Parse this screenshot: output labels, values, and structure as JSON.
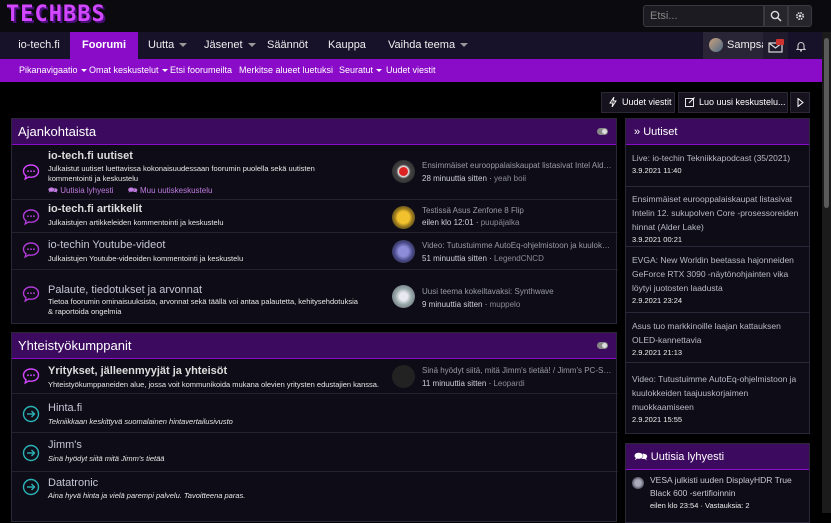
{
  "logo": {
    "text": "TECHBBS"
  },
  "search": {
    "placeholder": "Etsi..."
  },
  "nav": {
    "tabs": [
      {
        "label": "io-tech.fi",
        "caret": false
      },
      {
        "label": "Foorumi",
        "caret": false,
        "active": true
      },
      {
        "label": "Uutta",
        "caret": true
      },
      {
        "label": "Jäsenet",
        "caret": true
      },
      {
        "label": "Säännöt",
        "caret": false
      },
      {
        "label": "Kauppa",
        "caret": false
      },
      {
        "label": "Vaihda teema",
        "caret": true
      }
    ],
    "user": "Sampsa"
  },
  "subnav": {
    "items": [
      {
        "label": "Pikanavigaatio",
        "caret": true
      },
      {
        "label": "Omat keskustelut",
        "caret": true
      },
      {
        "label": "Etsi foorumeilta",
        "caret": false
      },
      {
        "label": "Merkitse alueet luetuksi",
        "caret": false
      },
      {
        "label": "Seuratut",
        "caret": true
      },
      {
        "label": "Uudet viestit",
        "caret": false
      }
    ]
  },
  "actions": {
    "new_posts": "Uudet viestit",
    "new_thread": "Luo uusi keskustelu..."
  },
  "colors": {
    "accent": "#8a0cc8",
    "header": "#3c0b5f",
    "link": "#bf7be0"
  },
  "ajankohtaista": {
    "title": "Ajankohtaista",
    "forums": [
      {
        "name": "io-tech.fi uutiset",
        "desc": "Julkaistut uutiset luettavissa kokonaisuudessaan foorumin puolella sekä uutisten kommentointi ja keskustelu",
        "sublinks": [
          "Uutisia lyhyesti",
          "Muu uutiskeskustelu"
        ],
        "last_title": "Ensimmäiset eurooppalaiskaupat listasivat Intel Alder Lake",
        "last_time": "28 minuuttia sitten",
        "last_user": "yeah boii"
      },
      {
        "name": "io-tech.fi artikkelit",
        "desc": "Julkaistujen artikkeleiden kommentointi ja keskustelu",
        "last_title": "Testissä Asus Zenfone 8 Flip",
        "last_time": "eilen klo 12:01",
        "last_user": "puupäjalka"
      },
      {
        "name": "io-techin Youtube-videot",
        "desc": "Julkaistujen Youtube-videoiden kommentointi ja keskustelu",
        "last_title": "Video: Tutustuimme AutoEq-ohjelmistoon ja kuulokkeiden",
        "last_time": "51 minuuttia sitten",
        "last_user": "LegendCNCD"
      },
      {
        "name": "Palaute, tiedotukset ja arvonnat",
        "desc": "Tietoa foorumin ominaisuuksista, arvonnat sekä täällä voi antaa palautetta, kehitysehdotuksia & raportoida ongelmia",
        "last_title": "Uusi teema kokeiltavaksi: Synthwave",
        "last_time": "9 minuuttia sitten",
        "last_user": "muppelo"
      }
    ]
  },
  "yhteistyo": {
    "title": "Yhteistyökumppanit",
    "forums": [
      {
        "name": "Yritykset, jälleenmyyjät ja yhteisöt",
        "desc": "Yhteistyökumppaneiden alue, jossa voit kommunikoida mukana olevien yritysten edustajien kanssa.",
        "last_title": "Sinä hyödyt siitä, mitä Jimm's tietää! / Jimm's PC-Store",
        "last_time": "11 minuuttia sitten",
        "last_user": "Leopardi"
      },
      {
        "name": "Hinta.fi",
        "desc": "Tekniikkaan keskittyvä suomalainen hintavertailusivusto"
      },
      {
        "name": "Jimm's",
        "desc": "Sinä hyödyt siitä mitä Jimm's tietää"
      },
      {
        "name": "Datatronic",
        "desc": "Aina hyvä hinta ja vielä parempi palvelu. Tavoitteena paras."
      }
    ]
  },
  "sidebar": {
    "news_title": "Uutiset",
    "news": [
      {
        "title": "Live: io-techin Tekniikkapodcast (35/2021)",
        "date": "3.9.2021 11:40"
      },
      {
        "title": "Ensimmäiset eurooppalaiskaupat listasivat Intelin 12. sukupolven Core -prosessoreiden hinnat (Alder Lake)",
        "date": "3.9.2021 00:21"
      },
      {
        "title": "EVGA: New Worldin beetassa hajonneiden GeForce RTX 3090 -näytönohjainten vika löytyi juotosten laadusta",
        "date": "2.9.2021 23:24"
      },
      {
        "title": "Asus tuo markkinoille laajan kattauksen OLED-kannettavia",
        "date": "2.9.2021 21:13"
      },
      {
        "title": "Video: Tutustuimme AutoEq-ohjelmistoon ja kuulokkeiden taajuuskorjaimen muokkaamiseen",
        "date": "2.9.2021 15:55"
      }
    ],
    "short_title": "Uutisia lyhyesti",
    "short": [
      {
        "title": "VESA julkisti uuden DisplayHDR True Black 600 -sertifioinnin",
        "meta": "eilen klo 23:54 · Vastauksia: 2"
      }
    ]
  }
}
